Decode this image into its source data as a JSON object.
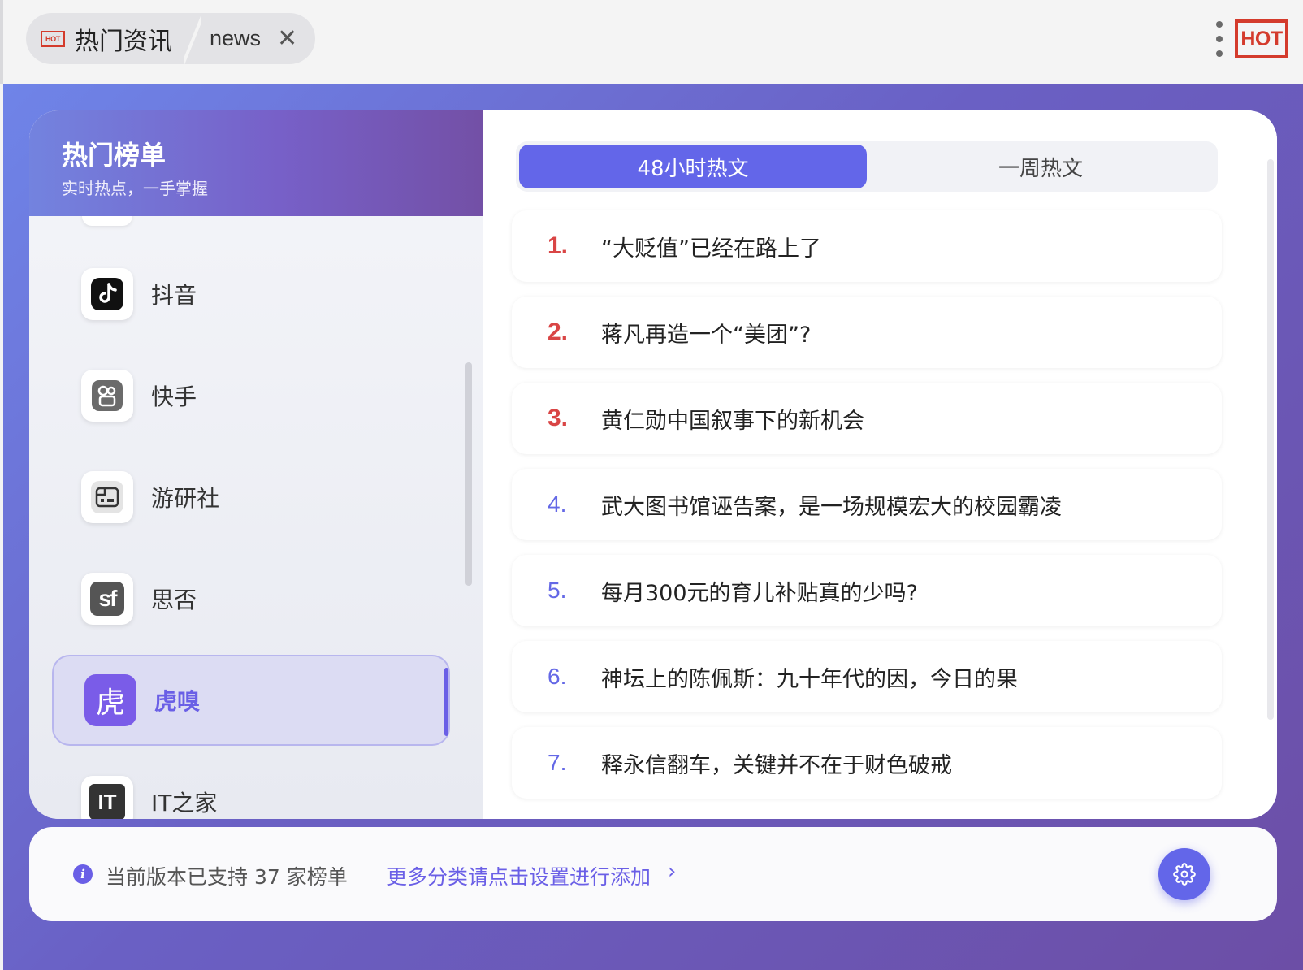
{
  "browser_tab": {
    "badge": "HOT",
    "title": "热门资讯",
    "subtitle": "news",
    "close": "✕"
  },
  "top_logo": "HOT",
  "sidebar": {
    "title": "热门榜单",
    "subtitle": "实时热点，一手掌握",
    "items": [
      {
        "label": "抖音",
        "icon": "douyin-icon"
      },
      {
        "label": "快手",
        "icon": "kuaishou-icon"
      },
      {
        "label": "游研社",
        "icon": "yystv-icon"
      },
      {
        "label": "思否",
        "icon": "segmentfault-icon",
        "glyph": "sf"
      },
      {
        "label": "虎嗅",
        "icon": "huxiu-icon",
        "glyph": "虎",
        "active": true
      },
      {
        "label": "IT之家",
        "icon": "ithome-icon",
        "glyph": "IT"
      }
    ]
  },
  "tabs": {
    "active": "48小时热文",
    "inactive": "一周热文"
  },
  "news": [
    {
      "rank": "1.",
      "title": "“大贬值”已经在路上了"
    },
    {
      "rank": "2.",
      "title": "蒋凡再造一个“美团”?"
    },
    {
      "rank": "3.",
      "title": "黄仁勋中国叙事下的新机会"
    },
    {
      "rank": "4.",
      "title": "武大图书馆诬告案，是一场规模宏大的校园霸凌"
    },
    {
      "rank": "5.",
      "title": "每月300元的育儿补贴真的少吗?"
    },
    {
      "rank": "6.",
      "title": "神坛上的陈佩斯：九十年代的因，今日的果"
    },
    {
      "rank": "7.",
      "title": "释永信翻车，关键并不在于财色破戒"
    }
  ],
  "footer": {
    "info": "当前版本已支持 37 家榜单",
    "link": "更多分类请点击设置进行添加",
    "chevron": "›"
  },
  "colors": {
    "accent": "#6366e9",
    "hot_rank": "#d94545",
    "logo_red": "#d43b2c"
  }
}
